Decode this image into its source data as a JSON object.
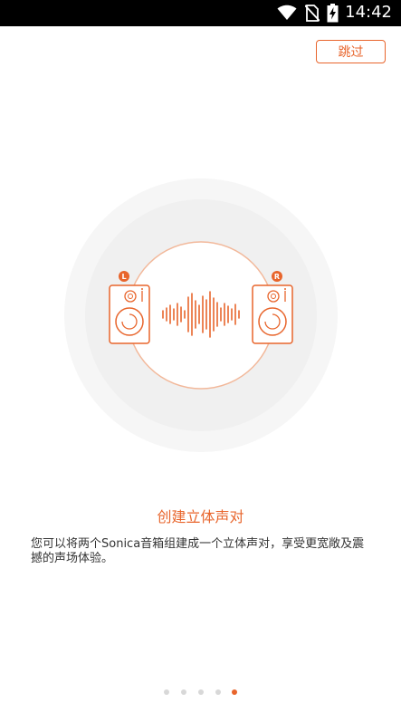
{
  "status_bar": {
    "time": "14:42",
    "icons": [
      "wifi-icon",
      "no-sim-icon",
      "battery-charging-icon"
    ]
  },
  "skip_button": {
    "label": "跳过"
  },
  "illustration": {
    "speakers": [
      {
        "channel_badge": "L"
      },
      {
        "channel_badge": "R"
      }
    ]
  },
  "content": {
    "title": "创建立体声对",
    "description": "您可以将两个Sonica音箱组建成一个立体声对，享受更宽敞及震撼的声场体验。"
  },
  "pagination": {
    "total": 5,
    "current": 5
  },
  "colors": {
    "accent": "#E8652C",
    "status_bar_bg": "#000000",
    "circle_outer": "#F6F6F6",
    "circle_inner": "#F0F0F0",
    "dot_inactive": "#D8D8D8"
  }
}
